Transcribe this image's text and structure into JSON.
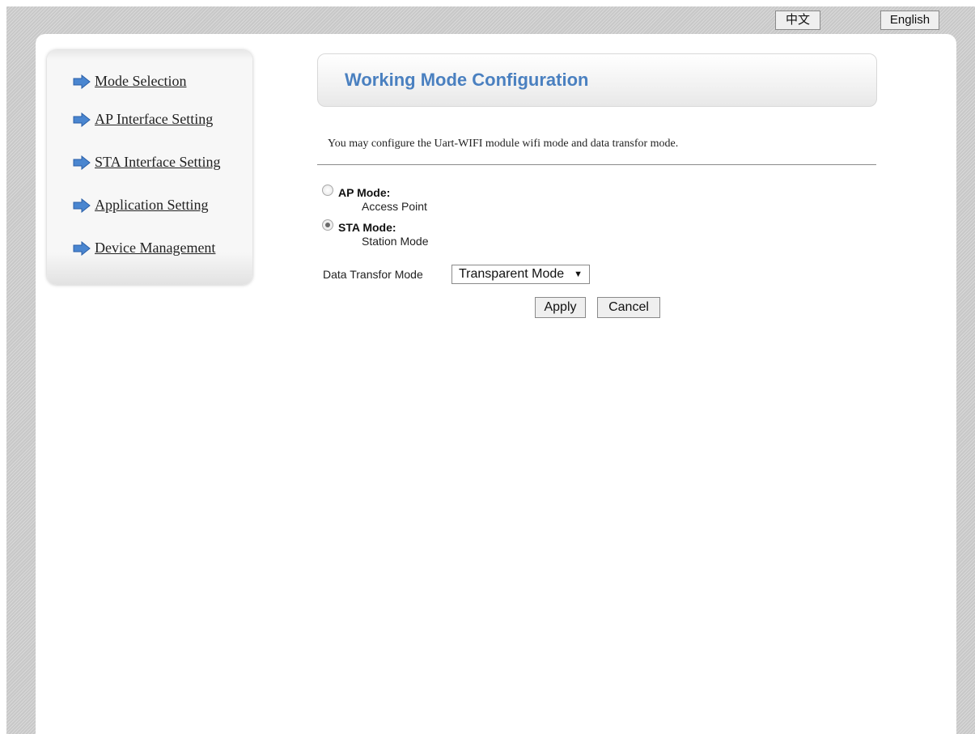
{
  "language": {
    "chinese_label": "中文",
    "english_label": "English"
  },
  "sidebar": {
    "items": [
      {
        "label": "Mode Selection",
        "icon": "arrow-right-icon"
      },
      {
        "label": "AP Interface Setting",
        "icon": "arrow-right-icon"
      },
      {
        "label": "STA Interface Setting",
        "icon": "arrow-right-icon"
      },
      {
        "label": "Application Setting",
        "icon": "arrow-right-icon"
      },
      {
        "label": "Device Management",
        "icon": "arrow-right-icon"
      }
    ]
  },
  "main": {
    "title": "Working Mode Configuration",
    "description": "You may configure the Uart-WIFI module wifi mode and data transfor mode.",
    "modes": [
      {
        "title": "AP Mode:",
        "subtitle": "Access Point",
        "selected": false
      },
      {
        "title": "STA Mode:",
        "subtitle": "Station Mode",
        "selected": true
      }
    ],
    "data_mode": {
      "label": "Data Transfor Mode",
      "value": "Transparent Mode"
    },
    "buttons": {
      "apply": "Apply",
      "cancel": "Cancel"
    }
  },
  "colors": {
    "title": "#4a80c0",
    "icon": "#4a86d0"
  }
}
